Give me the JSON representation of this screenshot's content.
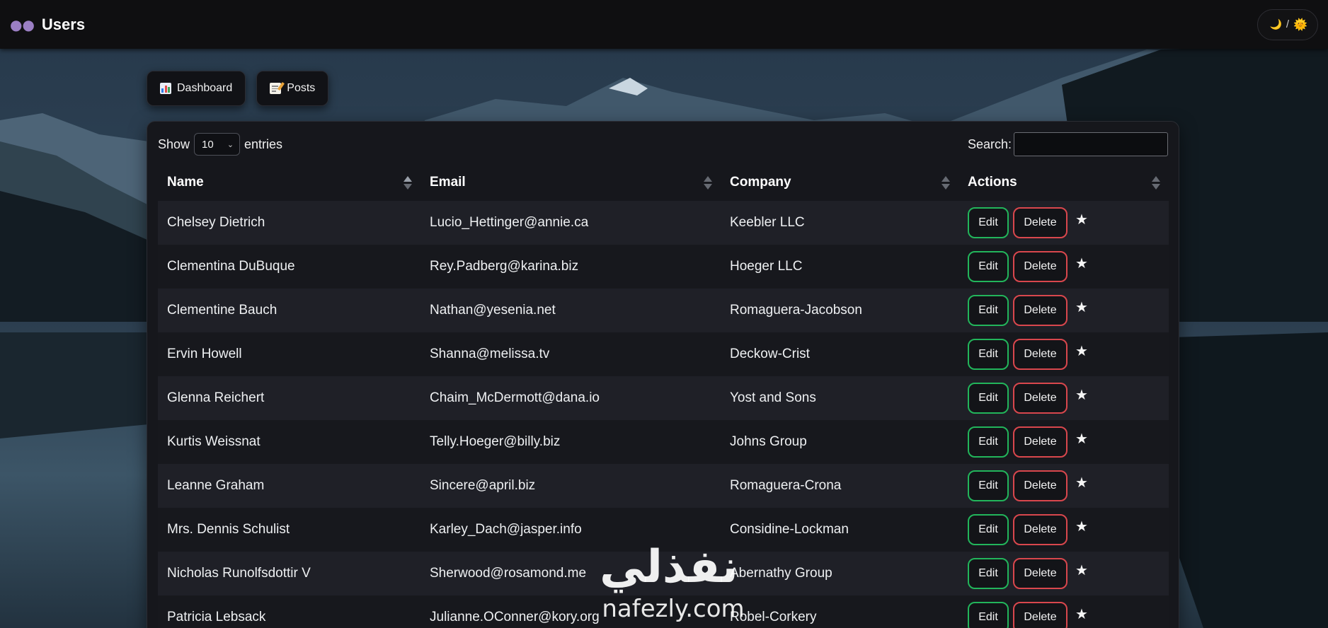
{
  "navbar": {
    "brand_icon": "busts-in-silhouette-icon",
    "title": "Users",
    "theme_toggle": {
      "moon": "🌙",
      "separator": "/",
      "sun": "🌞"
    }
  },
  "nav": {
    "dashboard": {
      "icon": "bar-chart-icon",
      "label": "Dashboard"
    },
    "posts": {
      "icon": "memo-icon",
      "label": "Posts"
    }
  },
  "table_controls": {
    "show_label": "Show",
    "page_size": "10",
    "entries_label": "entries",
    "search_label": "Search:",
    "search_value": ""
  },
  "table": {
    "columns": [
      "Name",
      "Email",
      "Company",
      "Actions"
    ],
    "sorted_column": "Name",
    "edit_label": "Edit",
    "delete_label": "Delete",
    "favorite_glyph": "★",
    "rows": [
      {
        "name": "Chelsey Dietrich",
        "email": "Lucio_Hettinger@annie.ca",
        "company": "Keebler LLC"
      },
      {
        "name": "Clementina DuBuque",
        "email": "Rey.Padberg@karina.biz",
        "company": "Hoeger LLC"
      },
      {
        "name": "Clementine Bauch",
        "email": "Nathan@yesenia.net",
        "company": "Romaguera-Jacobson"
      },
      {
        "name": "Ervin Howell",
        "email": "Shanna@melissa.tv",
        "company": "Deckow-Crist"
      },
      {
        "name": "Glenna Reichert",
        "email": "Chaim_McDermott@dana.io",
        "company": "Yost and Sons"
      },
      {
        "name": "Kurtis Weissnat",
        "email": "Telly.Hoeger@billy.biz",
        "company": "Johns Group"
      },
      {
        "name": "Leanne Graham",
        "email": "Sincere@april.biz",
        "company": "Romaguera-Crona"
      },
      {
        "name": "Mrs. Dennis Schulist",
        "email": "Karley_Dach@jasper.info",
        "company": "Considine-Lockman"
      },
      {
        "name": "Nicholas Runolfsdottir V",
        "email": "Sherwood@rosamond.me",
        "company": "Abernathy Group"
      },
      {
        "name": "Patricia Lebsack",
        "email": "Julianne.OConner@kory.org",
        "company": "Robel-Corkery"
      }
    ]
  },
  "watermark": {
    "arabic": "نفذلي",
    "latin": "nafezly.com"
  },
  "colors": {
    "navbar_bg": "#0f0f11",
    "card_bg": "#16171c",
    "edit_border": "#22b55b",
    "delete_border": "#d9474d"
  }
}
